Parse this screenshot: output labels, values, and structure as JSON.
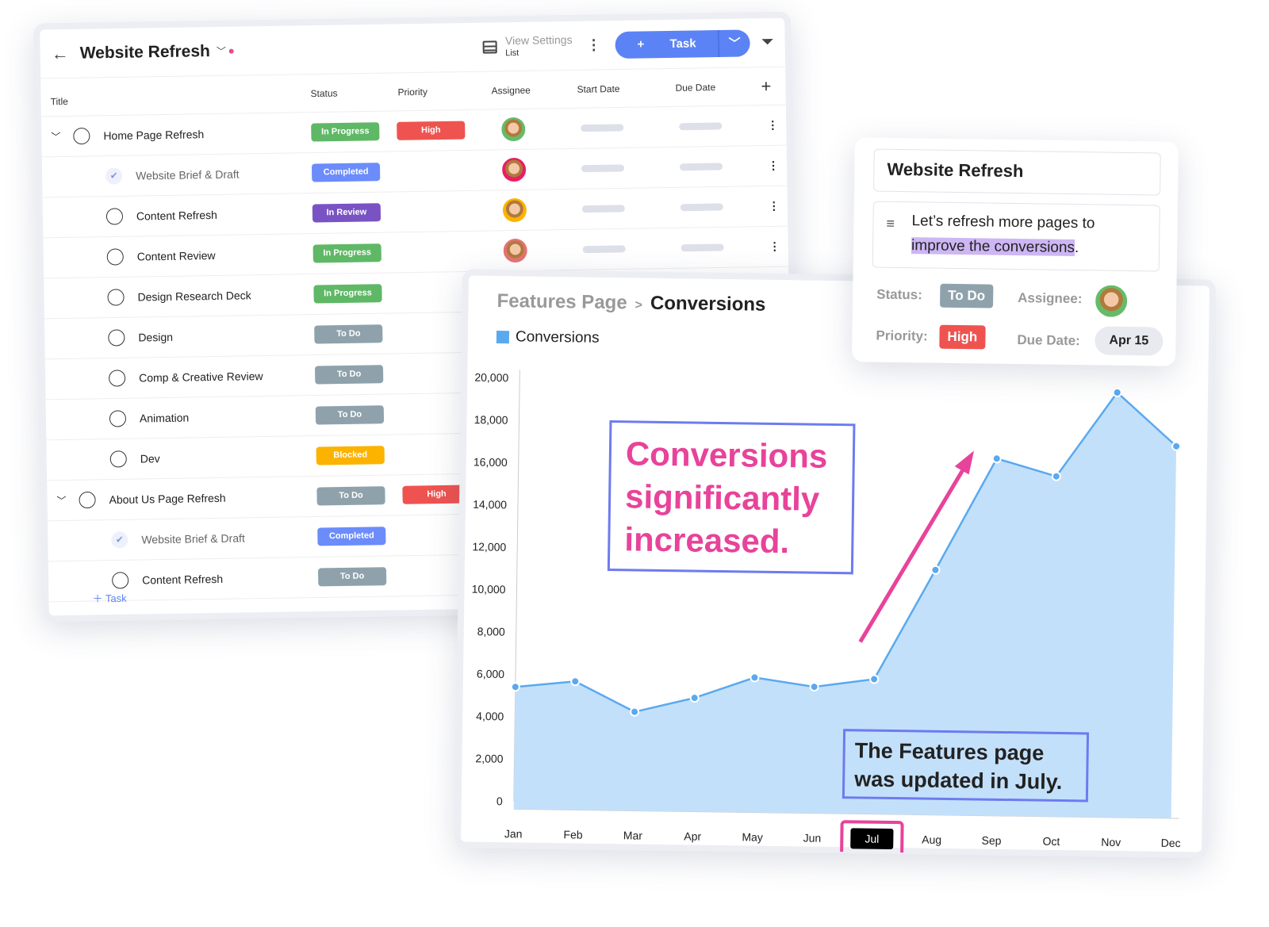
{
  "tasks_panel": {
    "title": "Website Refresh",
    "view_settings": "View Settings",
    "view_mode": "List",
    "task_button": "Task",
    "add_task": "Task",
    "columns": {
      "title": "Title",
      "status": "Status",
      "priority": "Priority",
      "assignee": "Assignee",
      "start": "Start Date",
      "due": "Due Date"
    },
    "rows": [
      {
        "title": "Home Page Refresh",
        "level": 0,
        "expand": true,
        "checked": false,
        "status": "In Progress",
        "priority": "High",
        "assignee": true
      },
      {
        "title": "Website Brief & Draft",
        "level": 1,
        "checked": true,
        "status": "Completed",
        "assignee": true
      },
      {
        "title": "Content Refresh",
        "level": 1,
        "checked": false,
        "status": "In Review",
        "assignee": true
      },
      {
        "title": "Content Review",
        "level": 1,
        "checked": false,
        "status": "In Progress",
        "assignee": true
      },
      {
        "title": "Design Research Deck",
        "level": 1,
        "checked": false,
        "status": "In Progress",
        "assignee": true
      },
      {
        "title": "Design",
        "level": 1,
        "checked": false,
        "status": "To Do"
      },
      {
        "title": "Comp & Creative Review",
        "level": 1,
        "checked": false,
        "status": "To Do"
      },
      {
        "title": "Animation",
        "level": 1,
        "checked": false,
        "status": "To Do"
      },
      {
        "title": "Dev",
        "level": 1,
        "checked": false,
        "status": "Blocked"
      },
      {
        "title": "About Us Page Refresh",
        "level": 0,
        "expand": true,
        "checked": false,
        "status": "To Do",
        "priority": "High"
      },
      {
        "title": "Website Brief & Draft",
        "level": 1,
        "checked": true,
        "status": "Completed"
      },
      {
        "title": "Content Refresh",
        "level": 1,
        "checked": false,
        "status": "To Do"
      }
    ],
    "status_colors": {
      "In Progress": "#5fb866",
      "Completed": "#6b8cfa",
      "In Review": "#7953c4",
      "To Do": "#8fa2ac",
      "Blocked": "#fbb300"
    },
    "priority_color": "#ef5350"
  },
  "chart_panel": {
    "breadcrumb_parent": "Features Page",
    "breadcrumb_current": "Conversions",
    "annotation_main": "Conversions significantly increased.",
    "annotation_note": "The Features page was updated in July.",
    "highlight_month": "Jul"
  },
  "chart_data": {
    "type": "area",
    "categories": [
      "Jan",
      "Feb",
      "Mar",
      "Apr",
      "May",
      "Jun",
      "Jul",
      "Aug",
      "Sep",
      "Oct",
      "Nov",
      "Dec"
    ],
    "series": [
      {
        "name": "Conversions",
        "values": [
          5400,
          5700,
          4300,
          5000,
          6000,
          5600,
          6000,
          11200,
          16500,
          15700,
          19700,
          17200
        ],
        "color": "#5aa9ef",
        "fill": "#c3e0fb"
      }
    ],
    "yticks": [
      "0",
      "2,000",
      "4,000",
      "6,000",
      "8,000",
      "10,000",
      "12,000",
      "14,000",
      "16,000",
      "18,000",
      "20,000"
    ],
    "ylim": [
      0,
      20000
    ],
    "grid": false,
    "legend": "top-left"
  },
  "detail_card": {
    "title": "Website Refresh",
    "desc_plain": "Let’s refresh more pages to ",
    "desc_highlight": "improve the conversions",
    "desc_end": ".",
    "status_label": "Status:",
    "status": "To Do",
    "assignee_label": "Assignee:",
    "priority_label": "Priority:",
    "priority": "High",
    "due_label": "Due Date:",
    "due": "Apr 15"
  }
}
